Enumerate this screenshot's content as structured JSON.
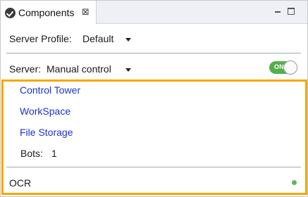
{
  "tab": {
    "title": "Components",
    "icon": "check-circle-icon",
    "close_glyph": "⊠"
  },
  "window_controls": {
    "minimize_icon": "minimize-icon",
    "maximize_icon": "maximize-icon"
  },
  "server_profile": {
    "label": "Server Profile:",
    "value": "Default"
  },
  "server": {
    "label": "Server:",
    "value": "Manual control",
    "toggle_text": "ON",
    "toggle_on": true
  },
  "components": {
    "links": [
      "Control Tower",
      "WorkSpace",
      "File Storage"
    ],
    "bots_label": "Bots:",
    "bots_value": "1"
  },
  "ocr": {
    "label": "OCR",
    "status_color": "#5cb85c"
  },
  "colors": {
    "accent_highlight": "#f5a800",
    "link": "#1c31d6",
    "toggle_on": "#52b04a"
  }
}
